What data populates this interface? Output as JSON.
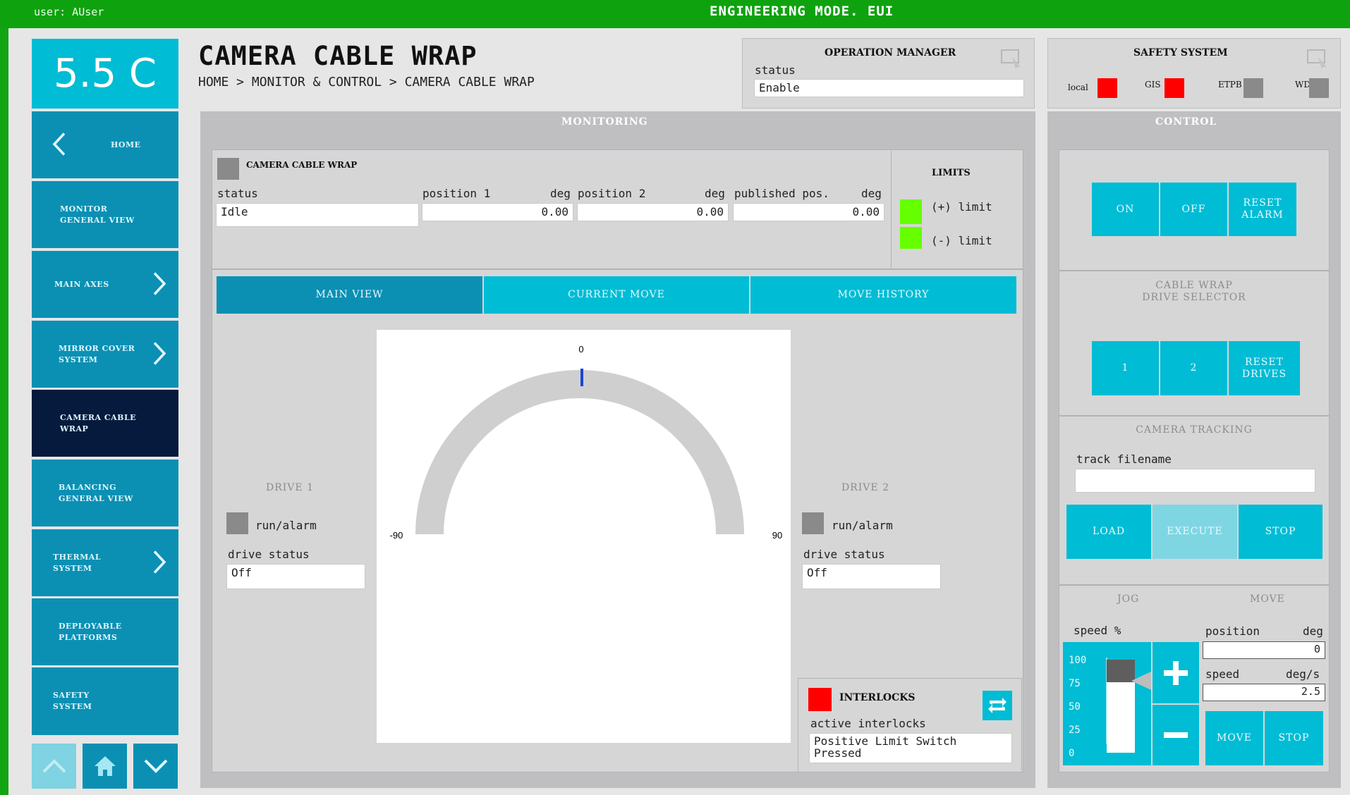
{
  "topbar": {
    "user": "user: AUser",
    "mode": "ENGINEERING MODE. EUI"
  },
  "sidebar": {
    "temperature": "5.5 C",
    "items": [
      {
        "label": "HOME",
        "icon": "chevron-left-icon"
      },
      {
        "label": "MONITOR\nGENERAL VIEW"
      },
      {
        "label": "MAIN AXES",
        "icon": "chevron-right-icon"
      },
      {
        "label": "MIRROR COVER\nSYSTEM",
        "icon": "chevron-right-icon"
      },
      {
        "label": "CAMERA CABLE\nWRAP",
        "active": true
      },
      {
        "label": "BALANCING\nGENERAL VIEW"
      },
      {
        "label": "THERMAL\nSYSTEM",
        "icon": "chevron-right-icon"
      },
      {
        "label": "DEPLOYABLE\nPLATFORMS"
      },
      {
        "label": "SAFETY\nSYSTEM"
      }
    ],
    "bottom_icons": [
      "chevron-up-icon",
      "home-icon",
      "chevron-down-icon"
    ]
  },
  "header": {
    "title": "CAMERA CABLE WRAP",
    "breadcrumb": "HOME > MONITOR & CONTROL > CAMERA CABLE WRAP"
  },
  "operation_manager": {
    "title": "OPERATION MANAGER",
    "status_label": "status",
    "status_value": "Enable"
  },
  "safety_system": {
    "title": "SAFETY SYSTEM",
    "indicators": [
      {
        "label": "local",
        "color": "#ff0000"
      },
      {
        "label": "GIS",
        "color": "#ff0000"
      },
      {
        "label": "ETPB",
        "color": "#8a8a8a"
      },
      {
        "label": "WD",
        "color": "#8a8a8a"
      }
    ]
  },
  "monitoring": {
    "title": "MONITORING",
    "ccw": {
      "title": "CAMERA CABLE WRAP",
      "status_label": "status",
      "status_value": "Idle",
      "position1_label": "position 1",
      "position2_label": "position 2",
      "published_label": "published pos.",
      "unit": "deg",
      "position1": "0.00",
      "position2": "0.00",
      "published": "0.00"
    },
    "limits": {
      "title": "LIMITS",
      "plus": "(+) limit",
      "minus": "(-) limit",
      "color": "#66ff00"
    },
    "tabs": [
      "MAIN VIEW",
      "CURRENT MOVE",
      "MOVE HISTORY"
    ],
    "gauge": {
      "top": "0",
      "left": "-90",
      "right": "90",
      "value": 0
    },
    "drive1": {
      "title": "DRIVE 1",
      "run_label": "run/alarm",
      "status_label": "drive status",
      "status_value": "Off"
    },
    "drive2": {
      "title": "DRIVE 2",
      "run_label": "run/alarm",
      "status_label": "drive status",
      "status_value": "Off"
    },
    "interlocks": {
      "title": "INTERLOCKS",
      "active_label": "active interlocks",
      "value": "Positive Limit Switch\nPressed",
      "color": "#ff0000"
    }
  },
  "control": {
    "title": "CONTROL",
    "on": "ON",
    "off": "OFF",
    "reset_alarm": "RESET\nALARM",
    "drive_selector_title": "CABLE WRAP\nDRIVE SELECTOR",
    "drive1": "1",
    "drive2": "2",
    "reset_drives": "RESET\nDRIVES",
    "tracking_title": "CAMERA TRACKING",
    "track_filename_label": "track filename",
    "track_filename_value": "",
    "load": "LOAD",
    "execute": "EXECUTE",
    "stop": "STOP",
    "jog_title": "JOG",
    "move_title": "MOVE",
    "speed_pct_label": "speed %",
    "scale": [
      "100",
      "75",
      "50",
      "25",
      "0"
    ],
    "position_label": "position",
    "position_unit": "deg",
    "position_value": "0",
    "speed_label": "speed",
    "speed_unit": "deg/s",
    "speed_value": "2.5",
    "move_btn": "MOVE",
    "stop_btn": "STOP",
    "jog_speed_pct": 75
  }
}
